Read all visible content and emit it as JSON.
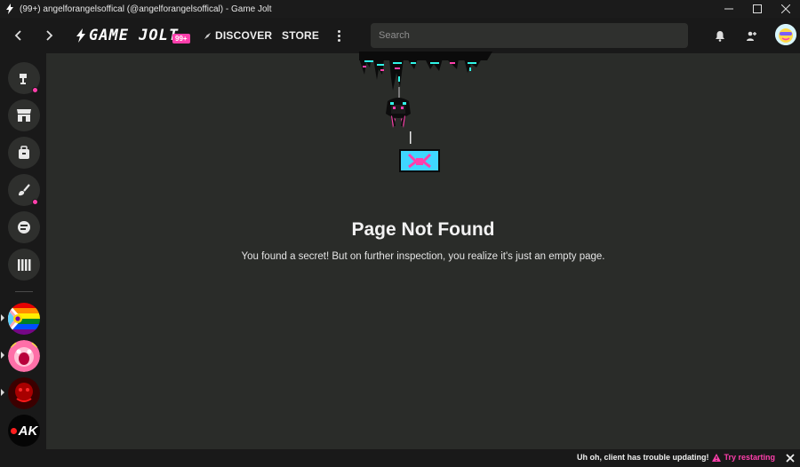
{
  "window": {
    "title": "(99+) angelforangelsoffical (@angelforangelsoffical) - Game Jolt"
  },
  "nav": {
    "logo_text": "GAME JOLT",
    "notification_badge": "99+",
    "discover_label": "DISCOVER",
    "store_label": "STORE",
    "search_placeholder": "Search"
  },
  "main": {
    "heading": "Page Not Found",
    "message": "You found a secret! But on further inspection, you realize it's just an empty page."
  },
  "sidebar": {
    "pinned_account_initials": "AK"
  },
  "status_bar": {
    "message": "Uh oh, client has trouble updating!",
    "action_label": "Try restarting"
  },
  "colors": {
    "accent": "#ff3fac",
    "highlight": "#2ff5e8",
    "background": "#2a2c29",
    "chrome": "#191919"
  }
}
